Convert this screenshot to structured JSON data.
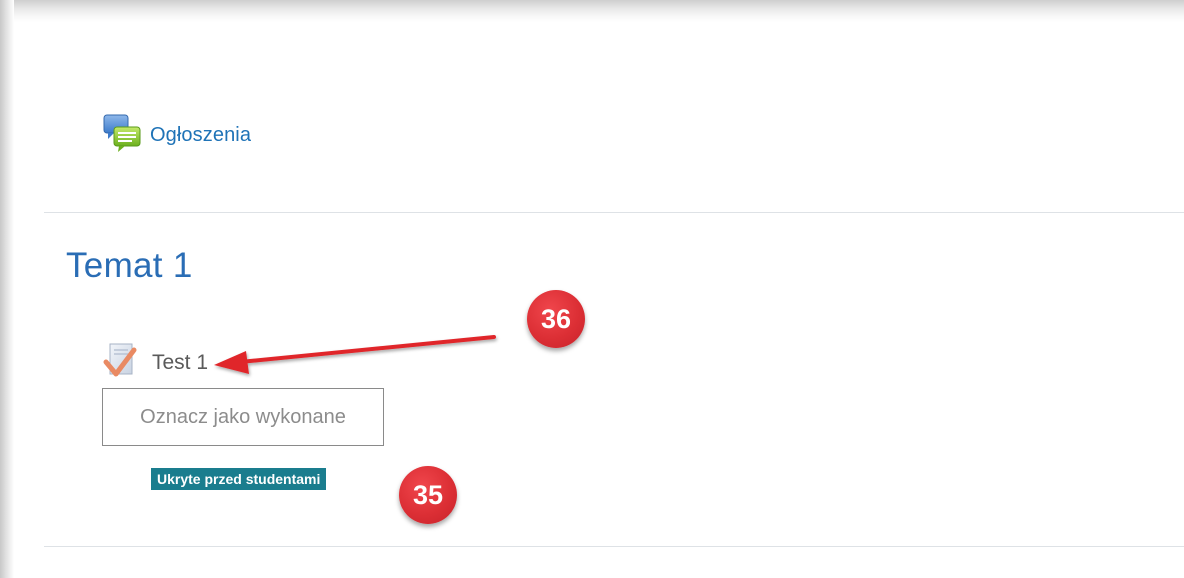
{
  "announcements": {
    "label": "Ogłoszenia",
    "icon": "forum-icon"
  },
  "section": {
    "title": "Temat 1"
  },
  "activity": {
    "name": "Test 1",
    "icon": "quiz-icon",
    "completion_button": "Oznacz jako wykonane",
    "visibility_badge": "Ukryte przed studentami"
  },
  "annotations": {
    "callout_1": "36",
    "callout_2": "35",
    "callout_color": "#dc2f35",
    "arrow_color": "#e0262c"
  },
  "colors": {
    "link": "#1f73b7",
    "section_title": "#2a6db5",
    "badge_bg": "#1a7d8e",
    "divider": "#dee2e6"
  }
}
